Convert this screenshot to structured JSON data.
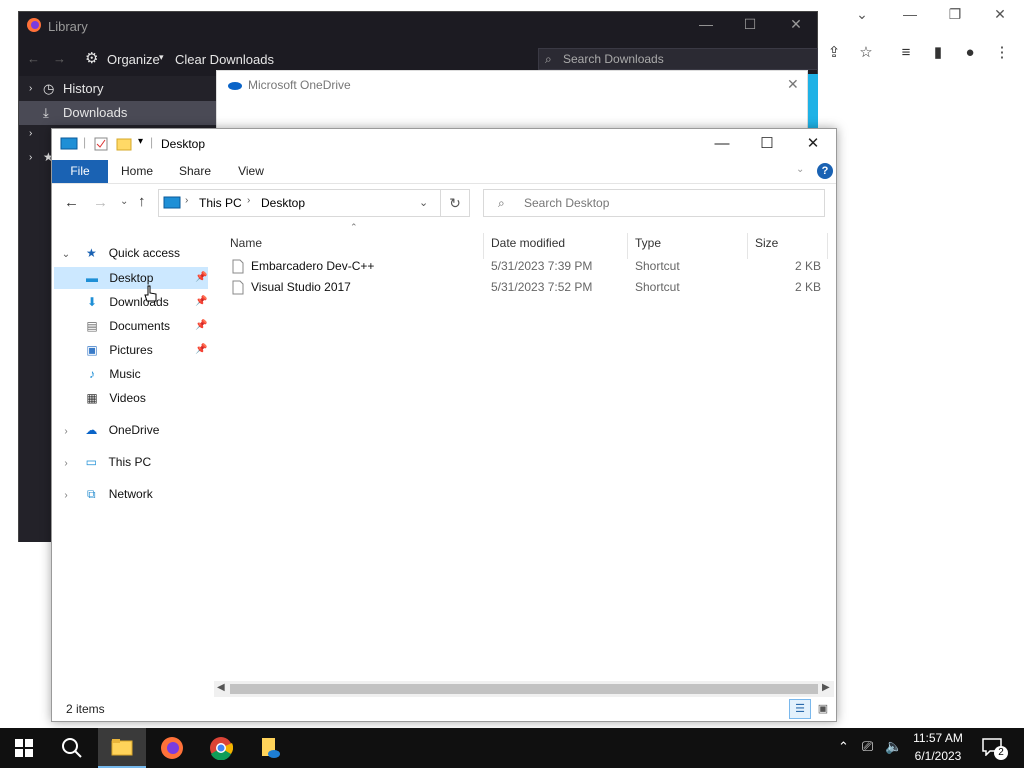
{
  "library": {
    "title": "Library",
    "organize": "Organize",
    "clear_downloads": "Clear Downloads",
    "search_placeholder": "Search Downloads",
    "items": [
      "History",
      "Downloads"
    ]
  },
  "onedrive": {
    "title": "Microsoft OneDrive"
  },
  "explorer": {
    "title": "Desktop",
    "tabs": [
      "File",
      "Home",
      "Share",
      "View"
    ],
    "breadcrumb": [
      "This PC",
      "Desktop"
    ],
    "search_placeholder": "Search Desktop",
    "nav": {
      "quick_access": "Quick access",
      "quick_items": [
        "Desktop",
        "Downloads",
        "Documents",
        "Pictures",
        "Music",
        "Videos"
      ],
      "onedrive": "OneDrive",
      "this_pc": "This PC",
      "network": "Network"
    },
    "columns": [
      "Name",
      "Date modified",
      "Type",
      "Size"
    ],
    "files": [
      {
        "name": "Embarcadero Dev-C++",
        "date": "5/31/2023 7:39 PM",
        "type": "Shortcut",
        "size": "2 KB"
      },
      {
        "name": "Visual Studio 2017",
        "date": "5/31/2023 7:52 PM",
        "type": "Shortcut",
        "size": "2 KB"
      }
    ],
    "status": "2 items"
  },
  "taskbar": {
    "time": "11:57 AM",
    "date": "6/1/2023",
    "notification_count": "2"
  },
  "colors": {
    "accent": "#1a62b3",
    "selection": "#cce8ff",
    "taskbar": "#101010"
  }
}
